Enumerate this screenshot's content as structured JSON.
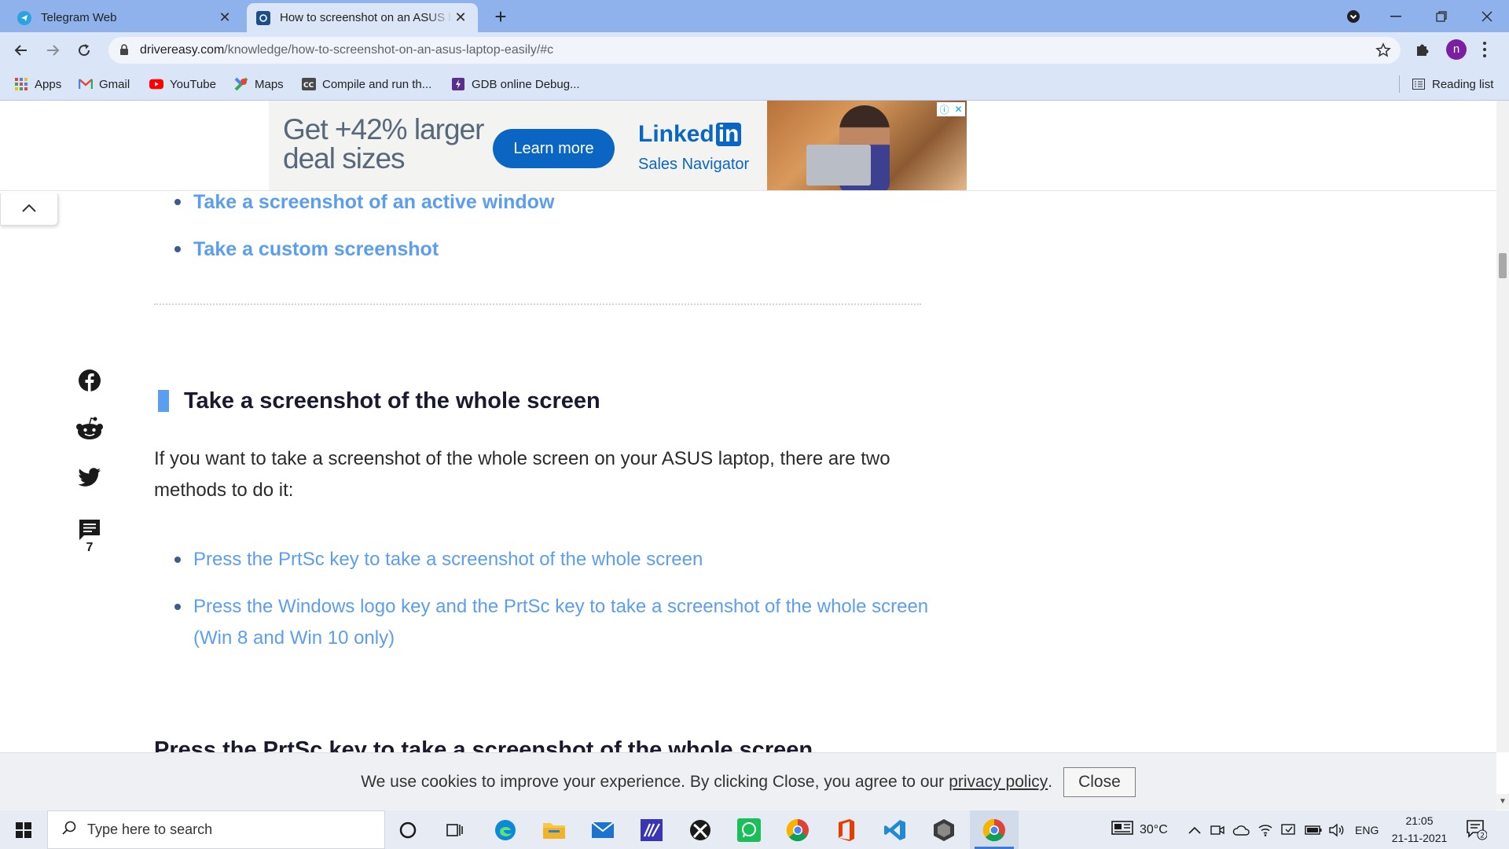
{
  "tabs": [
    {
      "label": "Telegram Web",
      "favicon": "telegram-icon",
      "active": false
    },
    {
      "label": "How to screenshot on an ASUS laptop easily",
      "favicon": "drivereasy-icon",
      "active": true
    }
  ],
  "toolbar": {
    "url_domain": "drivereasy.com",
    "url_path": "/knowledge/how-to-screenshot-on-an-asus-laptop-easily/#c",
    "profile_initial": "n"
  },
  "bookmarks": [
    {
      "label": "Apps",
      "icon": "apps-grid-icon"
    },
    {
      "label": "Gmail",
      "icon": "gmail-icon"
    },
    {
      "label": "YouTube",
      "icon": "youtube-icon"
    },
    {
      "label": "Maps",
      "icon": "maps-icon"
    },
    {
      "label": "Compile and run th...",
      "icon": "cc-icon"
    },
    {
      "label": "GDB online Debug...",
      "icon": "gdb-icon"
    }
  ],
  "reading_list": "Reading list",
  "ad": {
    "headline": "Get +42% larger deal sizes",
    "button": "Learn more",
    "brand": "Linked",
    "brand_in": "in",
    "product": "Sales Navigator"
  },
  "toc_items": [
    "Take a screenshot of an active window",
    "Take a custom screenshot"
  ],
  "share": {
    "comment_count": "7"
  },
  "article": {
    "heading": "Take a screenshot of the whole screen",
    "paragraph": "If you want to take a screenshot of the whole screen on your ASUS laptop, there are two methods to do it:",
    "links": [
      "Press the PrtSc key to take a screenshot of the whole screen",
      "Press the Windows logo key and the PrtSc key to take a screenshot of the whole screen (Win 8 and Win 10 only)"
    ],
    "next_heading": "Press the PrtSc key to take a screenshot of the whole screen"
  },
  "cookie": {
    "text": "We use cookies to improve your experience. By clicking Close, you agree to our",
    "link": "privacy policy",
    "period": ".",
    "button": "Close"
  },
  "taskbar": {
    "search_placeholder": "Type here to search",
    "temperature": "30°C",
    "language": "ENG",
    "time": "21:05",
    "date": "21-11-2021",
    "notification_count": "2"
  },
  "colors": {
    "accent_link": "#5b9ef0",
    "tabstrip": "#8fb2ec",
    "toolbar": "#dbe5f8",
    "linkedin_blue": "#0a66c2"
  }
}
